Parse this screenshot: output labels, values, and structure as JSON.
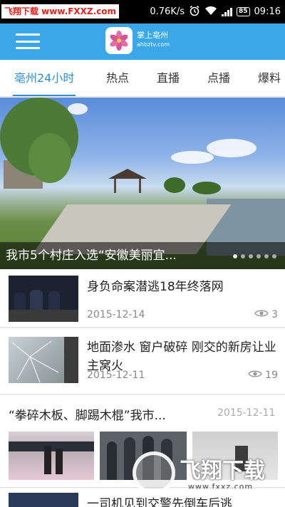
{
  "status_bar": {
    "watermark": "飞翔下载 www.FXXZ.com",
    "speed": "0.76K/s",
    "battery": "85",
    "time": "09:16"
  },
  "header": {
    "logo_text_line1": "掌上亳州",
    "logo_text_line2": "ahbztv.com"
  },
  "tabs": [
    {
      "label": "亳州24小时",
      "active": true
    },
    {
      "label": "热点"
    },
    {
      "label": "直播"
    },
    {
      "label": "点播"
    },
    {
      "label": "爆料"
    }
  ],
  "banner": {
    "caption": "我市5个村庄入选“安徽美丽宜...",
    "page_count": 6,
    "active_index": 0
  },
  "news": [
    {
      "title": "身负命案潜逃18年终落网",
      "date": "2015-12-14",
      "views": "3"
    },
    {
      "title": "地面渗水 窗户破碎 刚交的新房让业主窝火",
      "date": "2015-12-11",
      "views": "19"
    }
  ],
  "gallery": {
    "title": "“拳碎木板、脚踢木棍”我市...",
    "date": "2015-12-11"
  },
  "partial_news": {
    "title": "一司机见到交警先倒车后逃"
  },
  "watermark_bottom": {
    "brand": "飞翔下载",
    "url": "www.fxxz.com"
  },
  "colors": {
    "brand": "#3aa8e8",
    "tab_active": "#2b8fd6"
  }
}
